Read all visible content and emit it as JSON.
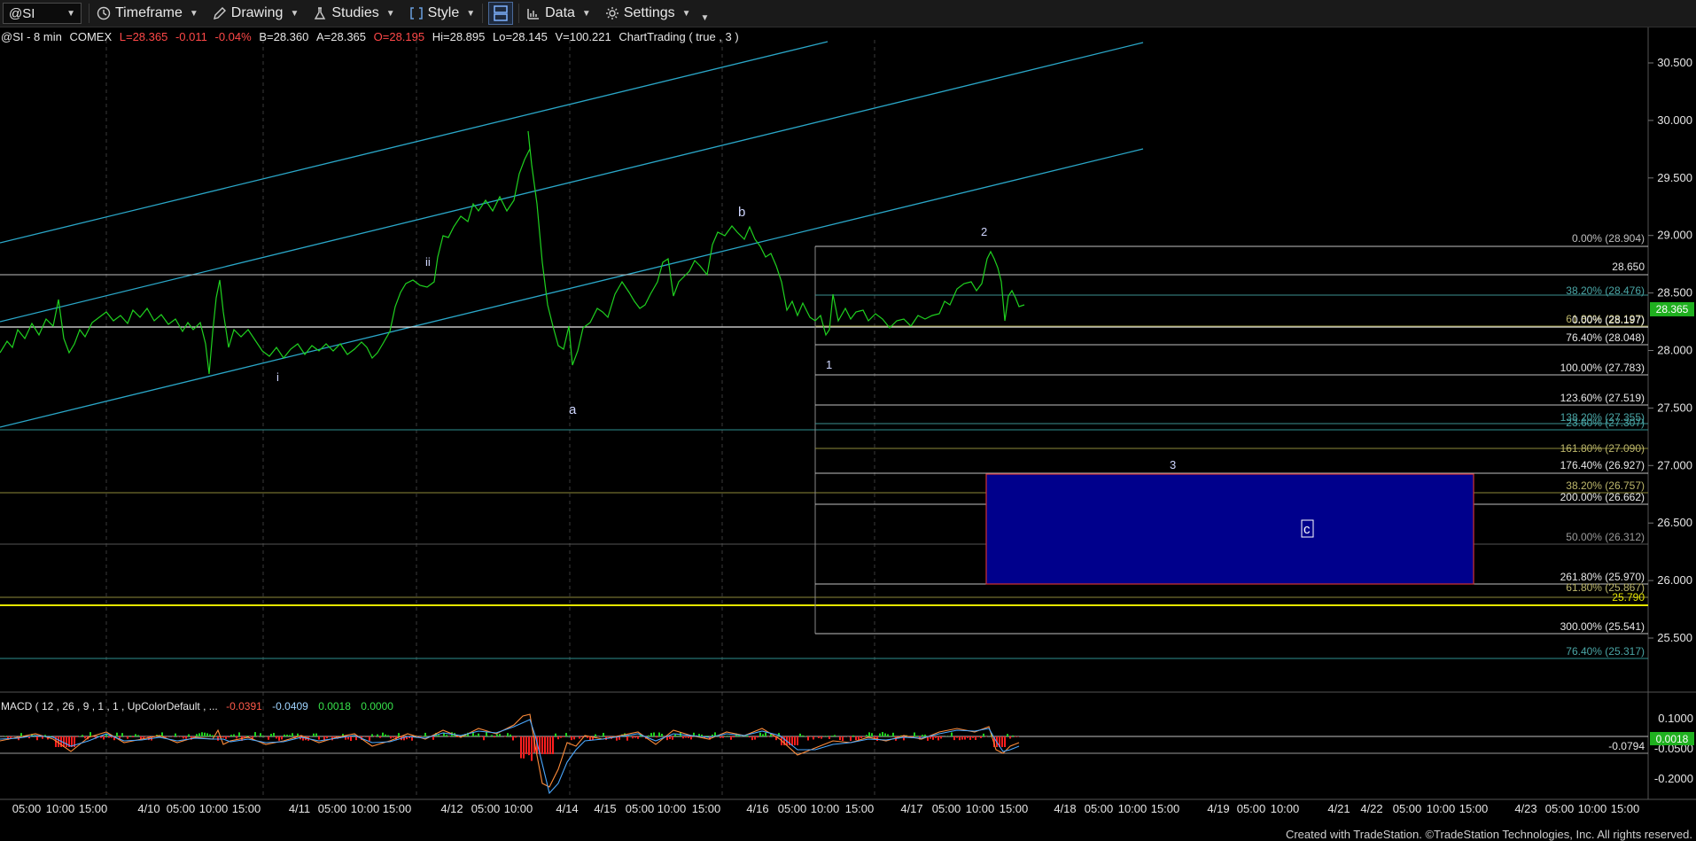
{
  "toolbar": {
    "symbol": "@SI",
    "timeframe_label": "Timeframe",
    "drawing_label": "Drawing",
    "studies_label": "Studies",
    "style_label": "Style",
    "data_label": "Data",
    "settings_label": "Settings"
  },
  "status": {
    "symbol_interval": "@SI - 8 min",
    "exchange": "COMEX",
    "last": "L=28.365",
    "change": "-0.011",
    "change_pct": "-0.04%",
    "bid": "B=28.360",
    "ask": "A=28.365",
    "open": "O=28.195",
    "high": "Hi=28.895",
    "low": "Lo=28.145",
    "volume": "V=100.221",
    "chart_trading": "ChartTrading ( true , 3 )"
  },
  "macd": {
    "label": "MACD ( 12 , 26 , 9 , 1 , 1 , UpColorDefault , ...",
    "macd_value": "-0.0391",
    "signal_value": "-0.0409",
    "hist_value": "0.0018",
    "zero_value": "0.0000",
    "axis_labels": [
      "0.1000",
      "-0.0500",
      "-0.2000"
    ],
    "hist_badge": "0.0018",
    "signal_badge": "-0.0794"
  },
  "price_axis": {
    "labels": [
      "30.500",
      "30.000",
      "29.500",
      "29.000",
      "28.500",
      "28.000",
      "27.500",
      "27.000",
      "26.500",
      "26.000",
      "25.500"
    ],
    "last_price": "28.365",
    "hline_upper": "28.650",
    "hline_lower": "25.790"
  },
  "fib_labels": [
    {
      "text": "0.00% (28.904)",
      "color": "#bfbfbf"
    },
    {
      "text": "38.20% (28.476)",
      "color": "#4aa6a6"
    },
    {
      "text": "61.80% (28.197)",
      "color": "#bdb76b"
    },
    {
      "text": "0.00% (28.197)",
      "color": "#e8e8e8"
    },
    {
      "text": "76.40% (28.048)",
      "color": "#e8e8e8"
    },
    {
      "text": "100.00% (27.783)",
      "color": "#e8e8e8"
    },
    {
      "text": "123.60% (27.519)",
      "color": "#e8e8e8"
    },
    {
      "text": "138.20% (27.355)",
      "color": "#4aa6a6"
    },
    {
      "text": "23.60% (27.307)",
      "color": "#4aa6a6"
    },
    {
      "text": "161.80% (27.090)",
      "color": "#bdb76b"
    },
    {
      "text": "176.40% (26.927)",
      "color": "#e8e8e8"
    },
    {
      "text": "38.20% (26.757)",
      "color": "#bdb76b"
    },
    {
      "text": "200.00% (26.662)",
      "color": "#e8e8e8"
    },
    {
      "text": "50.00% (26.312)",
      "color": "#9a9a9a"
    },
    {
      "text": "261.80% (25.970)",
      "color": "#e8e8e8"
    },
    {
      "text": "61.80% (25.867)",
      "color": "#bdb76b"
    },
    {
      "text": "300.00% (25.541)",
      "color": "#e8e8e8"
    },
    {
      "text": "76.40% (25.317)",
      "color": "#4aa6a6"
    }
  ],
  "wave_labels": {
    "i": "i",
    "ii": "ii",
    "a": "a",
    "b": "b",
    "one": "1",
    "two": "2",
    "three": "3",
    "c": "c"
  },
  "time_axis": [
    "05:00",
    "10:00",
    "15:00",
    "4/10",
    "05:00",
    "10:00",
    "15:00",
    "4/11",
    "05:00",
    "10:00",
    "15:00",
    "4/12",
    "05:00",
    "10:00",
    "4/14",
    "4/15",
    "05:00",
    "10:00",
    "15:00",
    "4/16",
    "05:00",
    "10:00",
    "15:00",
    "4/17",
    "05:00",
    "10:00",
    "15:00",
    "4/18",
    "05:00",
    "10:00",
    "15:00",
    "4/19",
    "05:00",
    "10:00",
    "4/21",
    "4/22",
    "05:00",
    "10:00",
    "15:00",
    "4/23",
    "05:00",
    "10:00",
    "15:00"
  ],
  "colors": {
    "background": "#000000",
    "price_line": "#1fd11f",
    "channel": "#2aa7c8",
    "target_box": "#00008c",
    "target_border": "#d23232",
    "yellow_line": "#e6e600",
    "last_price_badge": "#1fb01f"
  },
  "footer": {
    "credit": "Created with TradeStation. ©TradeStation Technologies, Inc. All rights reserved."
  }
}
